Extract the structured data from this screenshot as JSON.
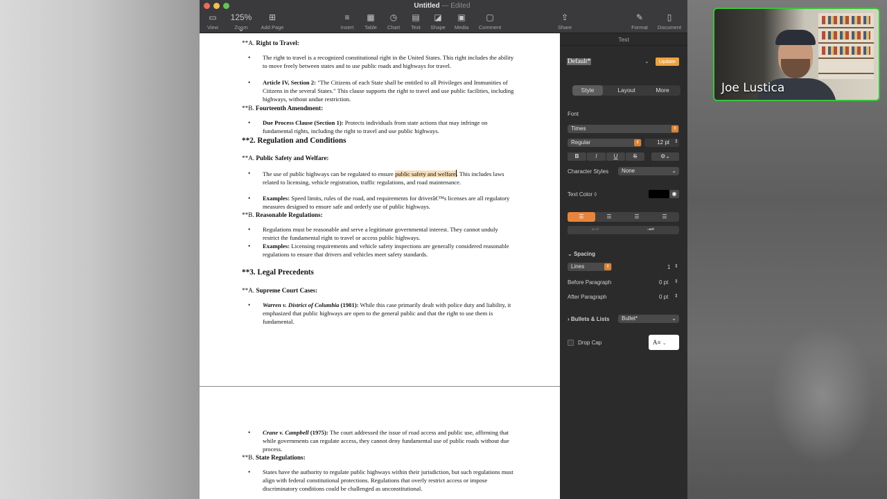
{
  "window": {
    "title": "Untitled",
    "status": "Edited"
  },
  "toolbar": {
    "view": "View",
    "zoom_value": "125%",
    "zoom": "Zoom",
    "add_page": "Add Page",
    "insert": "Insert",
    "table": "Table",
    "chart": "Chart",
    "text": "Text",
    "shape": "Shape",
    "media": "Media",
    "comment": "Comment",
    "share": "Share",
    "format": "Format",
    "document": "Document"
  },
  "document": {
    "p1": {
      "h_a": "**A.",
      "h_a_title": "Right to Travel:",
      "b1": "The right to travel is a recognized constitutional right in the United States. This right includes the ability to move freely between states and to use public roads and highways for travel.",
      "b2_bold": "Article IV, Section 2:",
      "b2": " \"The Citizens of each State shall be entitled to all Privileges and Immunities of Citizens in the several States.\" This clause supports the right to travel and use public facilities, including highways, without undue restriction.",
      "h_b": "**B.",
      "h_b_title": "Fourteenth Amendment:",
      "b3_bold": "Due Process Clause (Section 1):",
      "b3": " Protects individuals from state actions that may infringe on fundamental rights, including the right to travel and use public highways.",
      "h2": "**2. Regulation and Conditions",
      "h_c": "**A.",
      "h_c_title": "Public Safety and Welfare:",
      "b4_pre": "The use of public highways can be regulated to ensure ",
      "b4_hl": "public safety and welfare",
      "b4_post": ". This includes laws related to licensing, vehicle registration, traffic regulations, and road maintenance.",
      "b5_bold": "Examples:",
      "b5": " Speed limits, rules of the road, and requirements for driverâ€™s licenses are all regulatory measures designed to ensure safe and orderly use of public highways.",
      "h_d": "**B.",
      "h_d_title": "Reasonable Regulations:",
      "b6": "Regulations must be reasonable and serve a legitimate governmental interest. They cannot unduly restrict the fundamental right to travel or access public highways.",
      "b7_bold": "Examples:",
      "b7": " Licensing requirements and vehicle safety inspections are generally considered reasonable regulations to ensure that drivers and vehicles meet safety standards.",
      "h3": "**3. Legal Precedents",
      "h_e": "**A.",
      "h_e_title": "Supreme Court Cases:",
      "b8_case": "Warren v. District of Columbia",
      "b8_year": " (1981):",
      "b8": " While this case primarily dealt with police duty and liability, it emphasized that public highways are open to the general public and that the right to use them is fundamental."
    },
    "p2": {
      "b9_case": "Crane v. Campbell",
      "b9_year": " (1975):",
      "b9": " The court addressed the issue of road access and public use, affirming that while governments can regulate access, they cannot deny fundamental use of public roads without due process.",
      "h_f": "**B.",
      "h_f_title": "State Regulations:",
      "b10": "States have the authority to regulate public highways within their jurisdiction, but such regulations must align with federal constitutional protections. Regulations that overly restrict access or impose discriminatory conditions could be challenged as unconstitutional."
    },
    "bullet": "•"
  },
  "panel": {
    "header": "Text",
    "style_name": "Default*",
    "update": "Update",
    "tabs": [
      "Style",
      "Layout",
      "More"
    ],
    "font_label": "Font",
    "font_family": "Times",
    "font_weight": "Regular",
    "font_size": "12 pt",
    "fmt_bold": "B",
    "fmt_italic": "I",
    "fmt_underline": "U",
    "fmt_strike": "S",
    "char_styles_label": "Character Styles",
    "char_styles_value": "None",
    "text_color_label": "Text Color ◊",
    "spacing_label": "Spacing",
    "spacing_mode": "Lines",
    "spacing_value": "1",
    "before_label": "Before Paragraph",
    "before_value": "0 pt",
    "after_label": "After Paragraph",
    "after_value": "0 pt",
    "bullets_label": "Bullets & Lists",
    "bullets_value": "Bullet*",
    "dropcap_label": "Drop Cap"
  },
  "webcam": {
    "name": "Joe Lustica"
  },
  "colors": {
    "accent": "#e8853a",
    "highlight": "#f7ddb7",
    "webcam_border": "#39c43a"
  }
}
